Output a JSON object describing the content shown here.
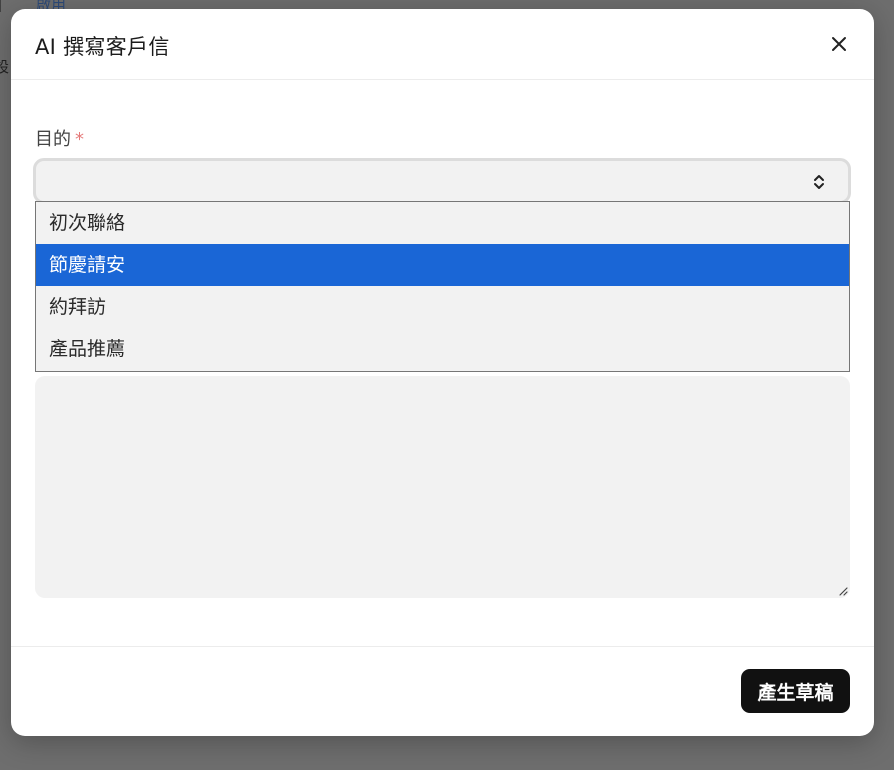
{
  "background": {
    "tab_fragment": "啟用",
    "left_fragment_top": "]",
    "left_fragment_mid": "設"
  },
  "modal": {
    "title": "AI 撰寫客戶信",
    "close_icon": "close-icon"
  },
  "form": {
    "purpose_label": "目的",
    "required_mark": "*",
    "select_value": "",
    "options": [
      {
        "label": "初次聯絡",
        "selected": false
      },
      {
        "label": "節慶請安",
        "selected": true
      },
      {
        "label": "約拜訪",
        "selected": false
      },
      {
        "label": "產品推薦",
        "selected": false
      }
    ],
    "textarea_value": ""
  },
  "footer": {
    "generate_label": "產生草稿"
  },
  "colors": {
    "accent": "#1a66d6",
    "primary_button": "#111111",
    "required": "#e57a7a"
  }
}
